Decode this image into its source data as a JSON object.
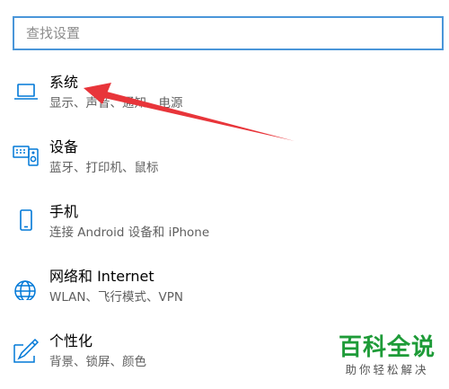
{
  "search": {
    "placeholder": "查找设置"
  },
  "items": [
    {
      "title": "系统",
      "subtitle": "显示、声音、通知、电源",
      "icon": "laptop-icon"
    },
    {
      "title": "设备",
      "subtitle": "蓝牙、打印机、鼠标",
      "icon": "devices-icon"
    },
    {
      "title": "手机",
      "subtitle": "连接 Android 设备和 iPhone",
      "icon": "phone-icon"
    },
    {
      "title": "网络和 Internet",
      "subtitle": "WLAN、飞行模式、VPN",
      "icon": "globe-icon"
    },
    {
      "title": "个性化",
      "subtitle": "背景、锁屏、颜色",
      "icon": "personalization-icon"
    }
  ],
  "watermark": {
    "main": "百科全说",
    "sub": "助你轻松解决"
  },
  "colors": {
    "accent": "#0078d7",
    "annotation_arrow": "#e8353a",
    "watermark_green": "#1e9b38"
  }
}
